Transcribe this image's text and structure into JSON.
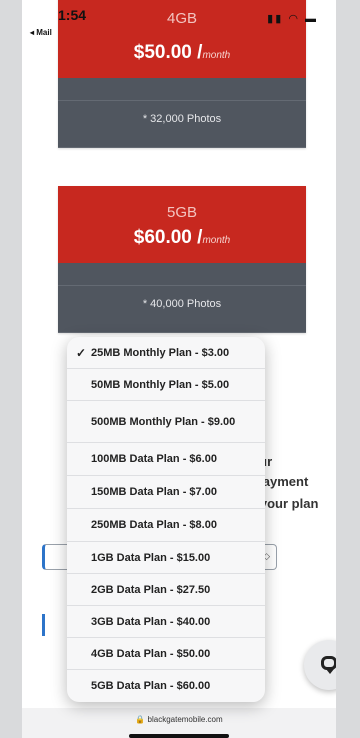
{
  "status": {
    "time": "1:54",
    "back_label": "◂ Mail",
    "icons": "signal-icon wifi-icon battery-icon"
  },
  "plans": [
    {
      "size": "4GB",
      "price": "$50.00 /",
      "per": "month",
      "feature": "* 32,000 Photos"
    },
    {
      "size": "5GB",
      "price": "$60.00 /",
      "per": "month",
      "feature": "* 40,000 Photos"
    }
  ],
  "background_text": {
    "line1": "your",
    "line2": "e payment",
    "line3": "to your plan"
  },
  "picker": {
    "selected_index": 0,
    "check": "✓",
    "options": [
      "25MB Monthly Plan - $3.00",
      "50MB Monthly Plan - $5.00",
      "500MB Monthly Plan - $9.00",
      "100MB Data Plan - $6.00",
      "150MB Data Plan - $7.00",
      "250MB Data Plan - $8.00",
      "1GB Data Plan - $15.00",
      "2GB Data Plan - $27.50",
      "3GB Data Plan - $40.00",
      "4GB Data Plan - $50.00",
      "5GB Data Plan - $60.00"
    ]
  },
  "url": "blackgatemobile.com",
  "colors": {
    "card_red": "#c7281f",
    "card_gray": "#50565f",
    "accent_blue": "#2d74c9"
  }
}
